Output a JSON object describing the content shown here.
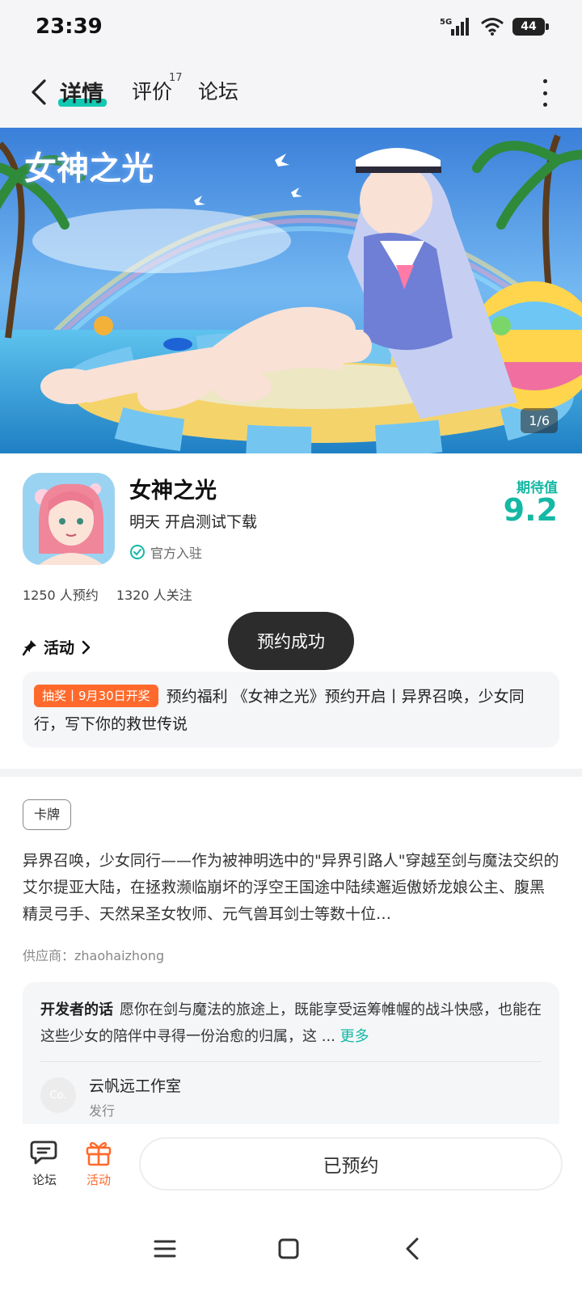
{
  "status_bar": {
    "time": "23:39",
    "network": "5G",
    "battery": "44"
  },
  "nav": {
    "tabs": [
      {
        "label": "详情",
        "active": true
      },
      {
        "label": "评价",
        "badge": "17"
      },
      {
        "label": "论坛"
      }
    ]
  },
  "banner": {
    "title_art": "女神之光",
    "counter": "1/6"
  },
  "app": {
    "name": "女神之光",
    "subtitle": "明天 开启测试下载",
    "official": "官方入驻",
    "rating_label": "期待值",
    "rating_value": "9.2",
    "reservations": "1250 人预约",
    "followers": "1320 人关注"
  },
  "activity": {
    "header": "活动",
    "tag": "抽奖丨9月30日开奖",
    "text": "预约福利 《女神之光》预约开启丨异界召唤，少女同行，写下你的救世传说"
  },
  "toast": "预约成功",
  "description": {
    "genre": "卡牌",
    "text": "异界召唤，少女同行——作为被神明选中的\"异界引路人\"穿越至剑与魔法交织的艾尔提亚大陆，在拯救濒临崩坏的浮空王国途中陆续邂逅傲娇龙娘公主、腹黑精灵弓手、天然呆圣女牧师、元气兽耳剑士等数十位…",
    "supplier": "供应商：zhaohaizhong"
  },
  "developer": {
    "title": "开发者的话",
    "text": "愿你在剑与魔法的旅途上，既能享受运筹帷幄的战斗快感，也能在这些少女的陪伴中寻得一份治愈的归属，这 ...",
    "more": "更多",
    "avatar_text": "Co.",
    "studio": "云帆远工作室",
    "role": "发行"
  },
  "bottom_bar": {
    "forum_label": "论坛",
    "activity_label": "活动",
    "reserve_label": "已预约"
  },
  "colors": {
    "accent": "#14b8a4",
    "orange": "#ff6a2c"
  }
}
